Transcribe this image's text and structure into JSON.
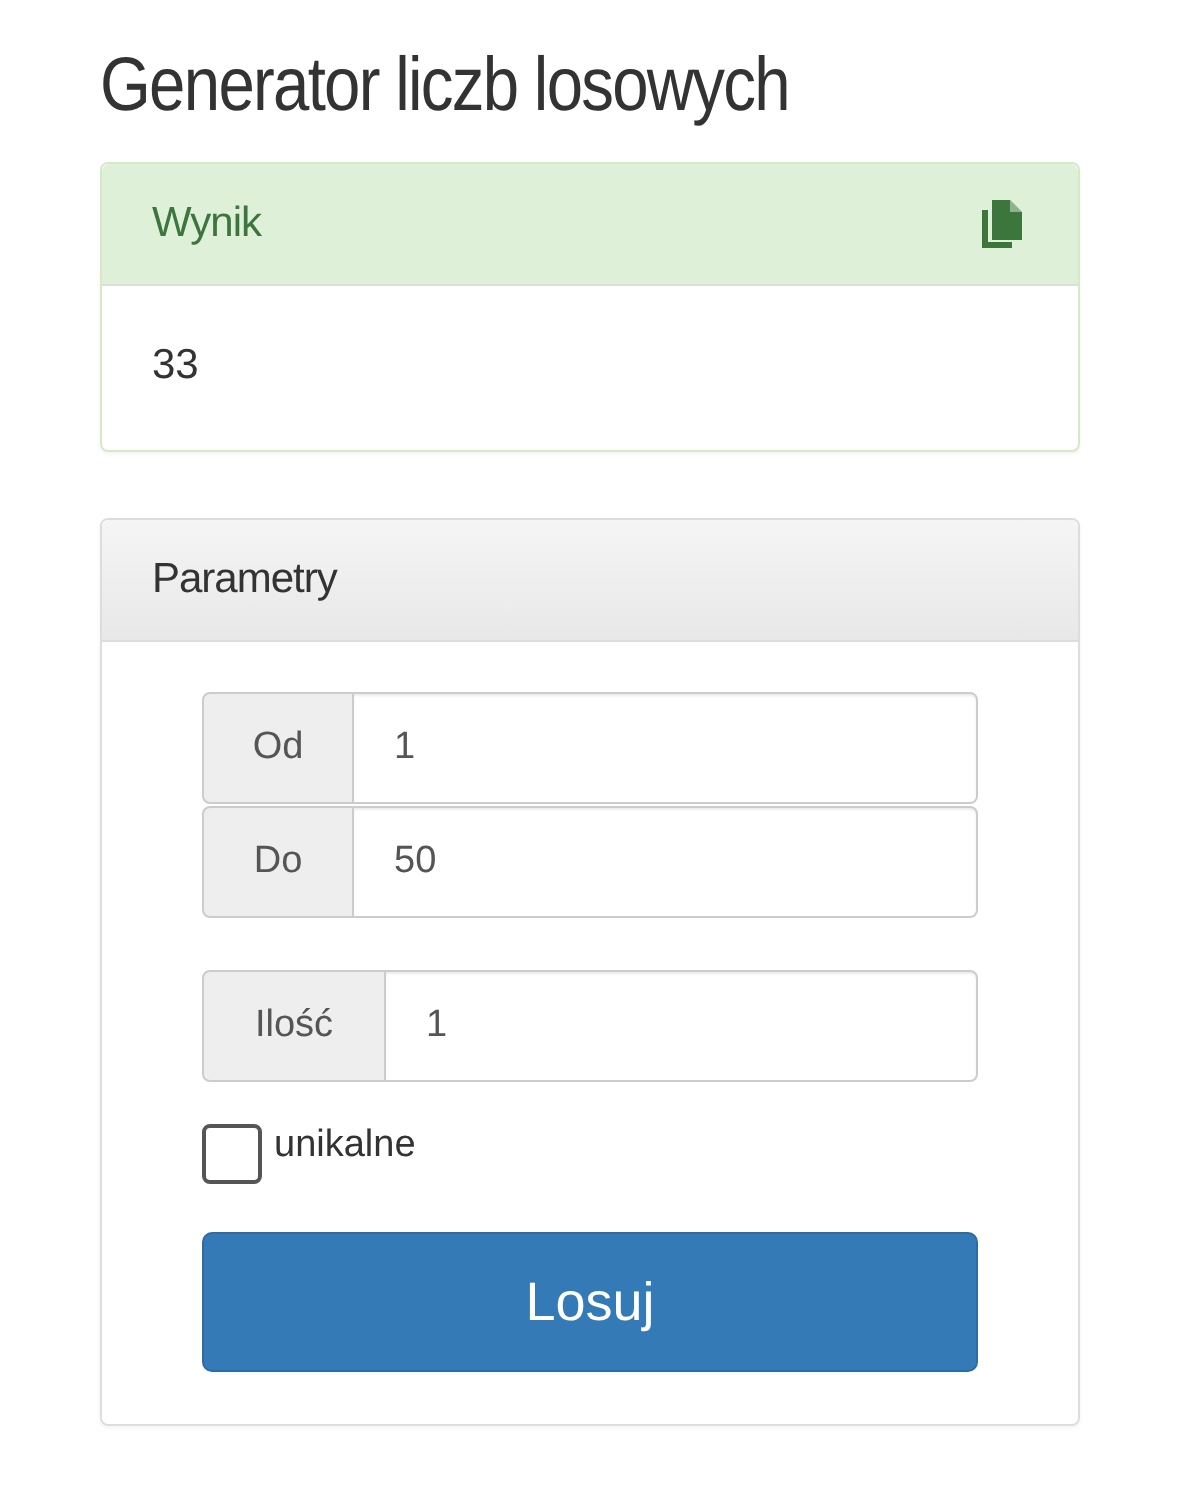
{
  "title": "Generator liczb losowych",
  "result": {
    "heading": "Wynik",
    "value": "33"
  },
  "parameters": {
    "heading": "Parametry",
    "range_fields": [
      {
        "label": "Od",
        "value": "1"
      },
      {
        "label": "Do",
        "value": "50"
      }
    ],
    "count_field": {
      "label": "Ilość",
      "value": "1"
    },
    "unique": {
      "label": "unikalne",
      "checked": false
    },
    "button": "Losuj"
  }
}
